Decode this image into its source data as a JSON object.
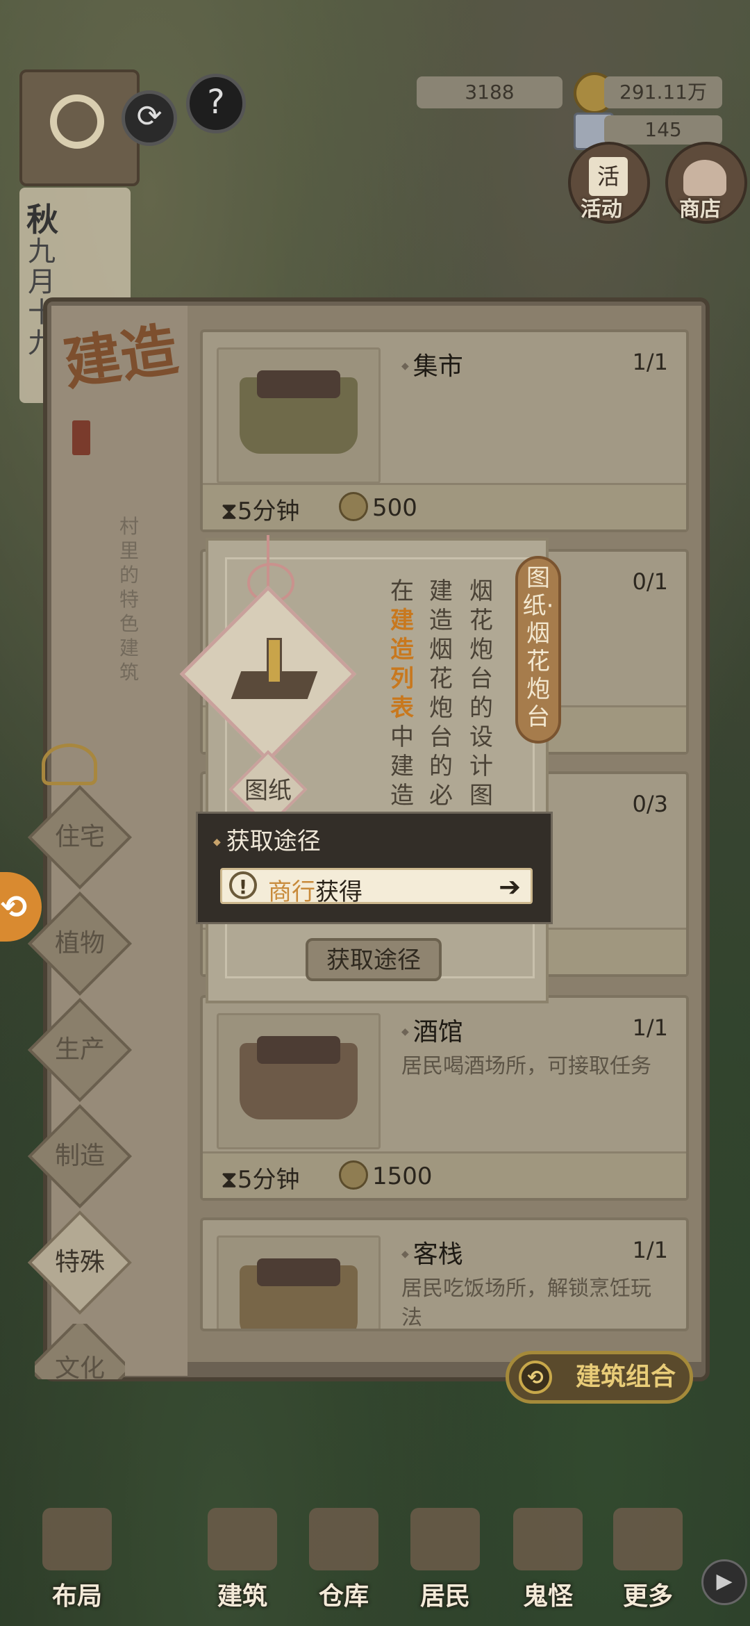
{
  "hud": {
    "resource1": "3188",
    "resource2": "291.11万",
    "resource3": "145",
    "season": "秋",
    "date": "九月十九",
    "activity_label": "活动",
    "activity_badge": "活",
    "shop_label": "商店"
  },
  "panel": {
    "title": "建造",
    "subtitle": "村里的特色建筑",
    "categories": [
      "住宅",
      "植物",
      "生产",
      "制造",
      "特殊",
      "文化"
    ],
    "active_category": "特殊"
  },
  "cards": [
    {
      "name": "集市",
      "count": "1/1",
      "time": "5分钟",
      "cost": "500",
      "desc": ""
    },
    {
      "name": "",
      "count": "0/1",
      "time": "",
      "cost": "",
      "desc": ""
    },
    {
      "name": "",
      "count": "0/3",
      "time": "",
      "cost": "",
      "desc": ""
    },
    {
      "name": "酒馆",
      "count": "1/1",
      "time": "5分钟",
      "cost": "1500",
      "desc": "居民喝酒场所，可接取任务"
    },
    {
      "name": "客栈",
      "count": "1/1",
      "time": "",
      "cost": "",
      "desc": "居民吃饭场所，解锁烹饪玩法"
    }
  ],
  "tooltip": {
    "tag": "图纸·烟花炮台",
    "col1": "烟花炮台的设计图纸",
    "col2": "建造烟花炮台的必备品",
    "col3_prefix": "在",
    "col3_highlight": "建造列表",
    "col3_suffix": "中建造消耗此",
    "item_type": "图纸"
  },
  "acquire": {
    "title": "获取途径",
    "source_shop": "商行",
    "source_get": "获得",
    "button": "获取途径"
  },
  "combo_button": "建筑组合",
  "nav": [
    "布局",
    "建筑",
    "仓库",
    "居民",
    "鬼怪",
    "更多"
  ]
}
